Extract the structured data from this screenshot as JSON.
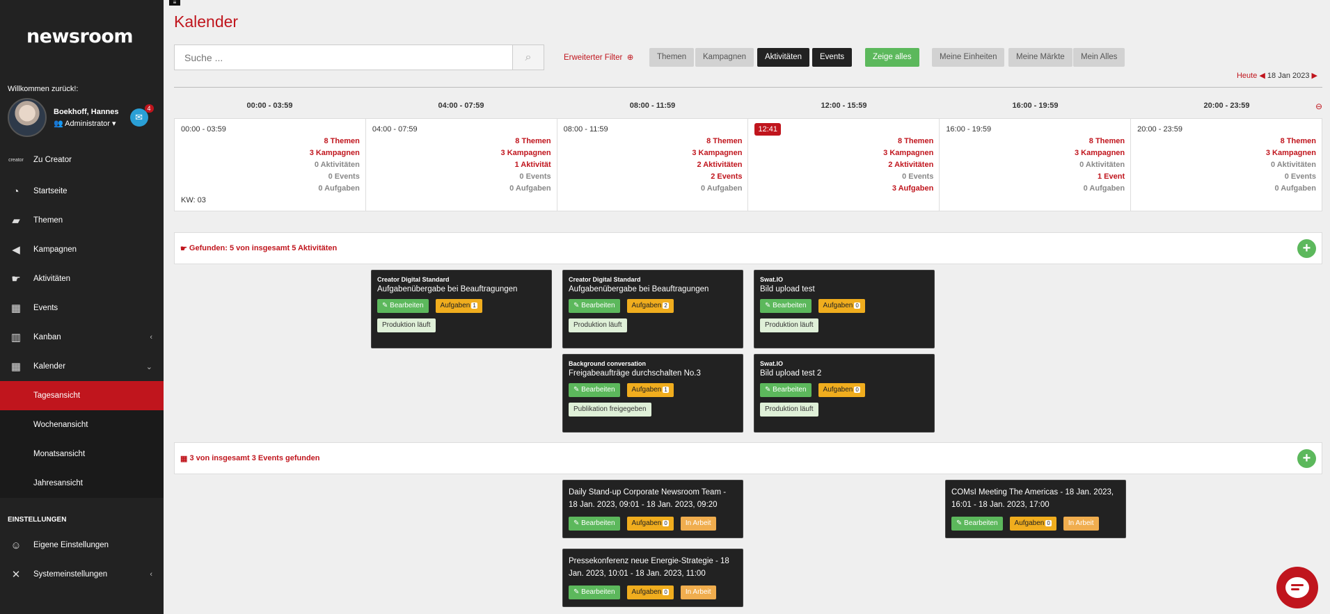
{
  "sidebar": {
    "logo": "newsroom",
    "welcome": "Willkommen zurück!:",
    "user_name": "Boekhoff, Hannes",
    "user_role": "Administrator",
    "mail_count": "4",
    "creator": "Zu Creator",
    "creator_logo": "creator",
    "items": [
      {
        "label": "Startseite",
        "icon": "dashboard-icon"
      },
      {
        "label": "Themen",
        "icon": "folder-icon"
      },
      {
        "label": "Kampagnen",
        "icon": "megaphone-icon"
      },
      {
        "label": "Aktivitäten",
        "icon": "pointing-hand-icon"
      },
      {
        "label": "Events",
        "icon": "calendar-check-icon"
      },
      {
        "label": "Kanban",
        "icon": "kanban-icon"
      },
      {
        "label": "Kalender",
        "icon": "calendar-icon"
      }
    ],
    "sub_items": [
      "Tagesansicht",
      "Wochenansicht",
      "Monatsansicht",
      "Jahresansicht"
    ],
    "settings_head": "EINSTELLUNGEN",
    "settings": [
      {
        "label": "Eigene Einstellungen",
        "icon": "user-cog-icon"
      },
      {
        "label": "Systemeinstellungen",
        "icon": "tools-icon"
      }
    ]
  },
  "header": {
    "title": "Kalender",
    "search_placeholder": "Suche ...",
    "adv_filter": "Erweiterter Filter",
    "buttons": [
      "Themen",
      "Kampagnen",
      "Aktivitäten",
      "Events",
      "Zeige alles",
      "Meine Einheiten",
      "Meine Märkte",
      "Mein Alles"
    ],
    "today_label": "Heute",
    "date": "18 Jan 2023"
  },
  "slots": [
    {
      "head": "00:00 - 03:59",
      "label": "00:00 - 03:59",
      "stats": [
        "8 Themen",
        "3 Kampagnen",
        "0 Aktivitäten",
        "0 Events",
        "0 Aufgaben"
      ]
    },
    {
      "head": "04:00 - 07:59",
      "label": "04:00 - 07:59",
      "stats": [
        "8 Themen",
        "3 Kampagnen",
        "1 Aktivität",
        "0 Events",
        "0 Aufgaben"
      ]
    },
    {
      "head": "08:00 - 11:59",
      "label": "08:00 - 11:59",
      "stats": [
        "8 Themen",
        "3 Kampagnen",
        "2 Aktivitäten",
        "2 Events",
        "0 Aufgaben"
      ]
    },
    {
      "head": "12:00 - 15:59",
      "label": "12:41",
      "stats": [
        "8 Themen",
        "3 Kampagnen",
        "2 Aktivitäten",
        "0 Events",
        "3 Aufgaben"
      ]
    },
    {
      "head": "16:00 - 19:59",
      "label": "16:00 - 19:59",
      "stats": [
        "8 Themen",
        "3 Kampagnen",
        "0 Aktivitäten",
        "1 Event",
        "0 Aufgaben"
      ]
    },
    {
      "head": "20:00 - 23:59",
      "label": "20:00 - 23:59",
      "stats": [
        "8 Themen",
        "3 Kampagnen",
        "0 Aktivitäten",
        "0 Events",
        "0 Aufgaben"
      ]
    }
  ],
  "kw": "KW: 03",
  "activities_found": "Gefunden: 5 von insgesamt 5 Aktivitäten",
  "events_found": "3 von insgesamt 3 Events gefunden",
  "labels": {
    "edit": "Bearbeiten",
    "tasks": "Aufgaben",
    "in_work": "In Arbeit"
  },
  "activities": [
    {
      "cat": "Creator Digital Standard",
      "title": "Aufgabenübergabe bei Beauftragungen",
      "count": "1",
      "status": "Produktion läuft"
    },
    {
      "cat": "Creator Digital Standard",
      "title": "Aufgabenübergabe bei Beauftragungen",
      "count": "2",
      "status": "Produktion läuft"
    },
    {
      "cat": "Swat.IO",
      "title": "Bild upload test",
      "count": "0",
      "status": "Produktion läuft"
    },
    {
      "cat": "Background conversation",
      "title": "Freigabeaufträge durchschalten No.3",
      "count": "1",
      "status": "Publikation freigegeben"
    },
    {
      "cat": "Swat.IO",
      "title": "Bild upload test 2",
      "count": "0",
      "status": "Produktion läuft"
    }
  ],
  "events": [
    {
      "title": "Daily Stand-up Corporate Newsroom Team - 18 Jan. 2023, 09:01 - 18 Jan. 2023, 09:20",
      "count": "0"
    },
    {
      "title": "COMsI Meeting The Americas - 18 Jan. 2023, 16:01 - 18 Jan. 2023, 17:00",
      "count": "0"
    },
    {
      "title": "Pressekonferenz neue Energie-Strategie - 18 Jan. 2023, 10:01 - 18 Jan. 2023, 11:00",
      "count": "0"
    }
  ],
  "colors": {
    "brand_red": "#c0151d",
    "green": "#5cb85c",
    "orange": "#f0ad1e"
  }
}
